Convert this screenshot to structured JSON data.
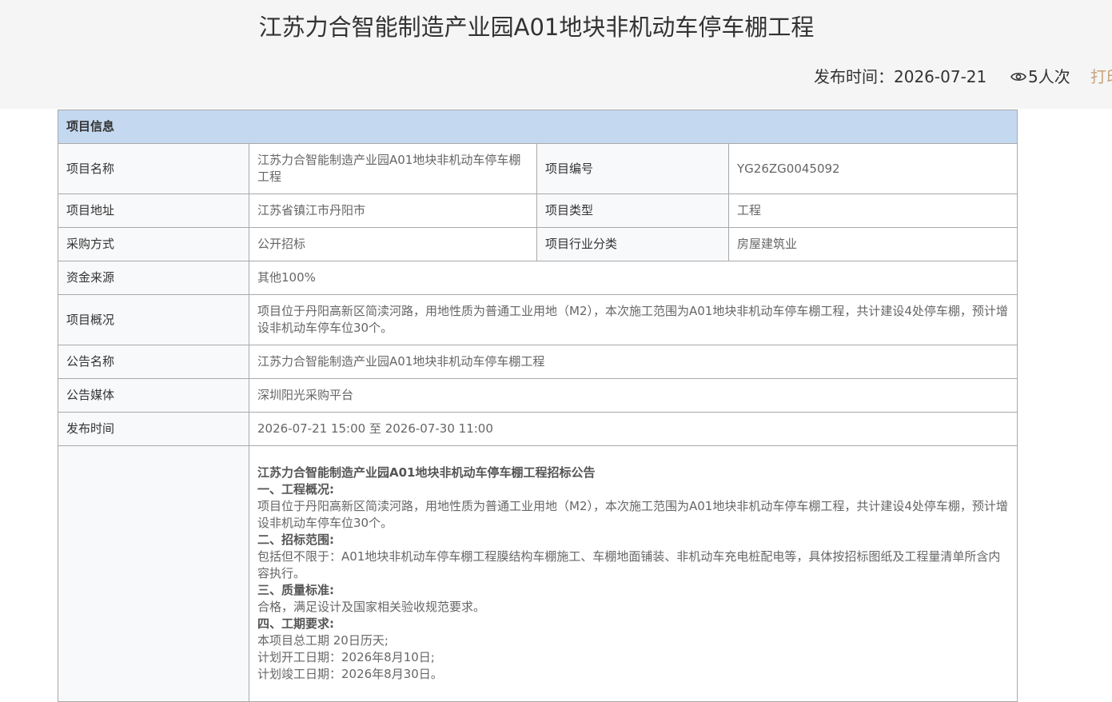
{
  "header": {
    "title": "江苏力合智能制造产业园A01地块非机动车停车棚工程",
    "publish_label": "发布时间：2026-07-21",
    "views": "5人次",
    "print_label": "打印"
  },
  "table": {
    "section_title": "项目信息",
    "rows": {
      "name_label": "项目名称",
      "name_value": "江苏力合智能制造产业园A01地块非机动车停车棚工程",
      "code_label": "项目编号",
      "code_value": "YG26ZG0045092",
      "address_label": "项目地址",
      "address_value": "江苏省镇江市丹阳市",
      "type_label": "项目类型",
      "type_value": "工程",
      "method_label": "采购方式",
      "method_value": "公开招标",
      "industry_label": "项目行业分类",
      "industry_value": "房屋建筑业",
      "fund_label": "资金来源",
      "fund_value": "其他100%",
      "overview_label": "项目概况",
      "overview_value": "项目位于丹阳高新区简渎河路，用地性质为普通工业用地（M2），本次施工范围为A01地块非机动车停车棚工程，共计建设4处停车棚，预计增设非机动车停车位30个。",
      "notice_name_label": "公告名称",
      "notice_name_value": "江苏力合智能制造产业园A01地块非机动车停车棚工程",
      "media_label": "公告媒体",
      "media_value": "深圳阳光采购平台",
      "time_label": "发布时间",
      "time_value": "2026-07-21 15:00 至 2026-07-30 11:00"
    },
    "content": {
      "heading": "江苏力合智能制造产业园A01地块非机动车停车棚工程招标公告",
      "s1_title": "一、工程概况:",
      "s1_text": "项目位于丹阳高新区简渎河路，用地性质为普通工业用地（M2），本次施工范围为A01地块非机动车停车棚工程，共计建设4处停车棚，预计增设非机动车停车位30个。",
      "s2_title": "二、招标范围:",
      "s2_text": "包括但不限于：A01地块非机动车停车棚工程膜结构车棚施工、车棚地面铺装、非机动车充电桩配电等，具体按招标图纸及工程量清单所含内容执行。",
      "s3_title": "三、质量标准:",
      "s3_text": "合格，满足设计及国家相关验收规范要求。",
      "s4_title": "四、工期要求:",
      "s4_line1": "本项目总工期 20日历天;",
      "s4_line2": "计划开工日期：2026年8月10日;",
      "s4_line3": "计划竣工日期：2026年8月30日。"
    }
  }
}
